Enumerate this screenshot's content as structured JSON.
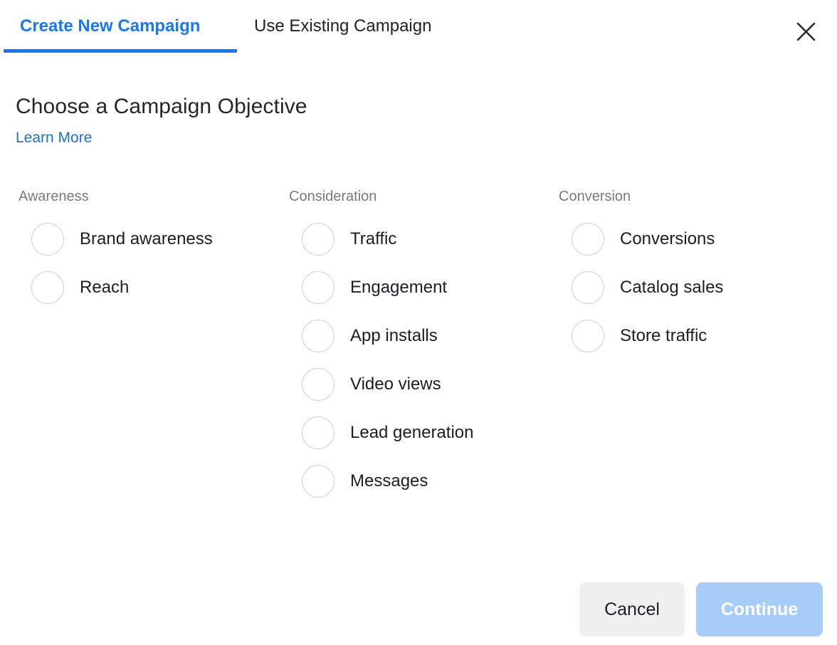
{
  "dialog": {
    "close_icon": "close-icon"
  },
  "tabs": [
    {
      "label": "Create New Campaign",
      "active": true
    },
    {
      "label": "Use Existing Campaign",
      "active": false
    }
  ],
  "header": {
    "title": "Choose a Campaign Objective",
    "learn_more": "Learn More"
  },
  "columns": [
    {
      "title": "Awareness",
      "options": [
        {
          "label": "Brand awareness",
          "selected": false
        },
        {
          "label": "Reach",
          "selected": false
        }
      ]
    },
    {
      "title": "Consideration",
      "options": [
        {
          "label": "Traffic",
          "selected": false
        },
        {
          "label": "Engagement",
          "selected": false
        },
        {
          "label": "App installs",
          "selected": false
        },
        {
          "label": "Video views",
          "selected": false
        },
        {
          "label": "Lead generation",
          "selected": false
        },
        {
          "label": "Messages",
          "selected": false
        }
      ]
    },
    {
      "title": "Conversion",
      "options": [
        {
          "label": "Conversions",
          "selected": false
        },
        {
          "label": "Catalog sales",
          "selected": false
        },
        {
          "label": "Store traffic",
          "selected": false
        }
      ]
    }
  ],
  "footer": {
    "cancel_label": "Cancel",
    "continue_label": "Continue",
    "continue_disabled": true
  },
  "colors": {
    "accent_blue": "#1877f2",
    "link_blue": "#1d6fd0",
    "continue_disabled_blue": "#a8ccf8",
    "cancel_gray": "#f0f0f0",
    "radio_border": "#d2d2d2",
    "column_title_gray": "#7a7a7a",
    "text_primary": "#1c1e21"
  }
}
